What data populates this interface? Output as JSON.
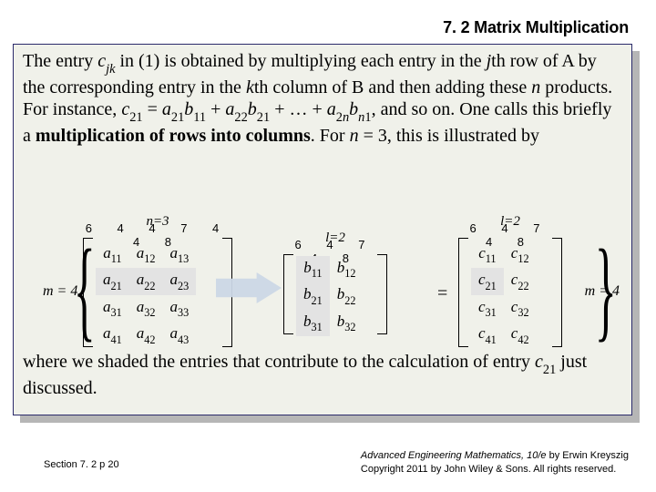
{
  "header": {
    "title": "7. 2 Matrix Multiplication"
  },
  "text": {
    "t1": "The entry ",
    "cjk_c": "c",
    "cjk_jk": "jk",
    "t2": " in (1) is obtained by multiplying each entry in the ",
    "jth_j": "j",
    "t3": "th row of A by the corresponding entry in the ",
    "kth_k": "k",
    "t4": "th column of B and then adding these ",
    "n1": "n",
    "t5": " products. For instance, ",
    "c21_c": "c",
    "c21_sub": "21",
    "t6": " = ",
    "a21_a": "a",
    "a21_sub": "21",
    "b11_b": "b",
    "b11_sub": "11",
    "t7": " + ",
    "a22_a": "a",
    "a22_sub": "22",
    "b21_b": "b",
    "b21_sub": "21",
    "t8": " + … + ",
    "a2n_a": "a",
    "a2n_sub_pre": "2",
    "a2n_sub_n": "n",
    "bn1_b": "b",
    "bn1_sub_n": "n",
    "bn1_sub_post": "1",
    "t9": ", and so on. One calls this briefly a ",
    "bold_phrase": "multiplication of rows into columns",
    "t10": ". For ",
    "n2": "n",
    "t11": " = 3, this is illustrated by",
    "bottom1": "where we shaded the entries that contribute to the calculation of entry ",
    "bottom_c21_c": "c",
    "bottom_c21_sub": "21",
    "bottom2": " just discussed."
  },
  "matrix": {
    "m_label": "m = 4",
    "eq": "=",
    "A_top_spec": "n=3",
    "A_digits": "6 4 4 7 4 4 8",
    "B_top_spec": "l=2",
    "B_digits": "6 4 7 4 8",
    "C_top_spec": "l=2",
    "C_digits": "6 4 7 4 8",
    "A": [
      [
        "a",
        "11",
        "a",
        "12",
        "a",
        "13"
      ],
      [
        "a",
        "21",
        "a",
        "22",
        "a",
        "23"
      ],
      [
        "a",
        "31",
        "a",
        "32",
        "a",
        "33"
      ],
      [
        "a",
        "41",
        "a",
        "42",
        "a",
        "43"
      ]
    ],
    "B": [
      [
        "b",
        "11",
        "b",
        "12"
      ],
      [
        "b",
        "21",
        "b",
        "22"
      ],
      [
        "b",
        "31",
        "b",
        "32"
      ]
    ],
    "C": [
      [
        "c",
        "11",
        "c",
        "12"
      ],
      [
        "c",
        "21",
        "c",
        "22"
      ],
      [
        "c",
        "31",
        "c",
        "32"
      ],
      [
        "c",
        "41",
        "c",
        "42"
      ]
    ]
  },
  "footer": {
    "left": "Section 7. 2  p 20",
    "right_title": "Advanced Engineering Mathematics, 10/e",
    "right_author": " by Erwin Kreyszig",
    "right_copy": "Copyright 2011 by John Wiley & Sons. All rights reserved."
  }
}
